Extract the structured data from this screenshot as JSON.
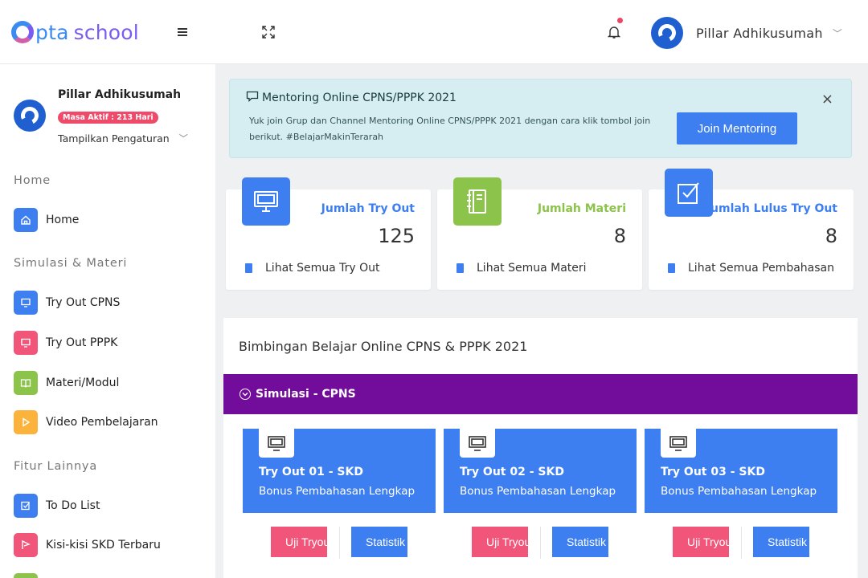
{
  "brand": {
    "logo_part1": "pta",
    "logo_part2": "school",
    "accent": "#3d7ff0"
  },
  "topbar": {
    "menu_icon": "hamburger-icon",
    "fullscreen_icon": "expand-icon",
    "notification_icon": "bell-icon",
    "user_name": "Pillar Adhikusumah"
  },
  "sidebar": {
    "profile": {
      "name": "Pillar Adhikusumah",
      "badge": "Masa Aktif : 213 Hari",
      "settings": "Tampilkan Pengaturan"
    },
    "sections": [
      {
        "title": "Home",
        "items": [
          {
            "label": "Home",
            "icon": "home-icon",
            "color": "#3d7ff0"
          }
        ]
      },
      {
        "title": "Simulasi & Materi",
        "items": [
          {
            "label": "Try Out CPNS",
            "icon": "monitor-icon",
            "color": "#3d7ff0"
          },
          {
            "label": "Try Out PPPK",
            "icon": "monitor-icon",
            "color": "#f2557a"
          },
          {
            "label": "Materi/Modul",
            "icon": "book-icon",
            "color": "#8cc34b"
          },
          {
            "label": "Video Pembelajaran",
            "icon": "play-icon",
            "color": "#fbb33b"
          }
        ]
      },
      {
        "title": "Fitur Lainnya",
        "items": [
          {
            "label": "To Do List",
            "icon": "checkbox-icon",
            "color": "#3d7ff0"
          },
          {
            "label": "Kisi-kisi SKD Terbaru",
            "icon": "flag-icon",
            "color": "#f2557a"
          }
        ]
      }
    ]
  },
  "alert": {
    "title": "Mentoring Online CPNS/PPPK 2021",
    "text": "Yuk join Grup dan Channel Mentoring Online CPNS/PPPK 2021 dengan cara klik tombol join berikut. #BelajarMakinTerarah",
    "button": "Join Mentoring",
    "close": "×"
  },
  "stats": [
    {
      "label": "Jumlah Try Out",
      "value": "125",
      "link": "Lihat Semua Try Out",
      "color": "#3d7ff0",
      "icon": "monitor-icon"
    },
    {
      "label": "Jumlah Materi",
      "value": "8",
      "link": "Lihat Semua Materi",
      "color": "#8cc34b",
      "icon": "notebook-icon"
    },
    {
      "label": "Jumlah Lulus Try Out",
      "value": "8",
      "link": "Lihat Semua Pembahasan",
      "color": "#3d7ff0",
      "icon": "checkbox-icon"
    }
  ],
  "panel": {
    "title": "Bimbingan Belajar Online CPNS & PPPK 2021",
    "section": "Simulasi - CPNS",
    "section_color": "#720d9b",
    "cards": [
      {
        "title": "Try Out 01 - SKD",
        "subtitle": "Bonus Pembahasan Lengkap",
        "btn1": "Uji Tryout",
        "btn2": "Statistik"
      },
      {
        "title": "Try Out 02 - SKD",
        "subtitle": "Bonus Pembahasan Lengkap",
        "btn1": "Uji Tryout",
        "btn2": "Statistik"
      },
      {
        "title": "Try Out 03 - SKD",
        "subtitle": "Bonus Pembahasan Lengkap",
        "btn1": "Uji Tryout",
        "btn2": "Statistik"
      }
    ]
  }
}
